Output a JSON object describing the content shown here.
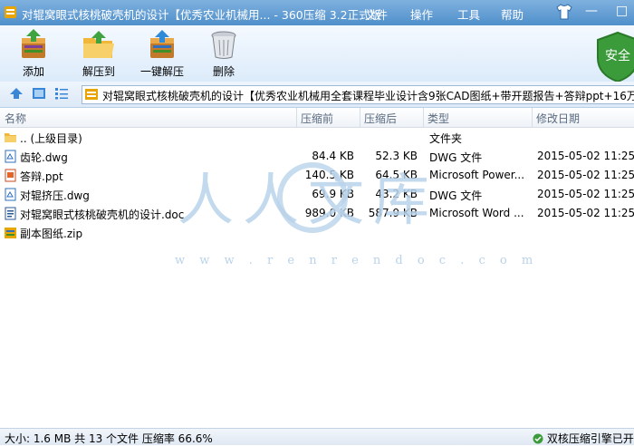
{
  "window": {
    "title": "对辊窝眼式核桃破壳机的设计【优秀农业机械用... - 360压缩 3.2正式版",
    "menu": [
      "文件",
      "操作",
      "工具",
      "帮助"
    ],
    "controls": {
      "minimize": "—",
      "maximize": "□"
    }
  },
  "toolbar": {
    "add": "添加",
    "extract_to": "解压到",
    "one_click_extract": "一键解压",
    "delete": "删除",
    "safe_badge": "安全"
  },
  "address": {
    "path": "对辊窝眼式核桃破壳机的设计【优秀农业机械用全套课程毕业设计含9张CAD图纸+带开题报告+答辩ppt+16万"
  },
  "columns": {
    "name": "名称",
    "size": "压缩前",
    "packed": "压缩后",
    "type": "类型",
    "modified": "修改日期"
  },
  "files": [
    {
      "icon": "folder-icon",
      "name": ".. (上级目录)",
      "size": "",
      "packed": "",
      "type": "文件夹",
      "modified": ""
    },
    {
      "icon": "dwg-file-icon",
      "name": "齿轮.dwg",
      "size": "84.4 KB",
      "packed": "52.3 KB",
      "type": "DWG 文件",
      "modified": "2015-05-02 11:25"
    },
    {
      "icon": "ppt-file-icon",
      "name": "答辩.ppt",
      "size": "140.5 KB",
      "packed": "64.5 KB",
      "type": "Microsoft Power...",
      "modified": "2015-05-02 11:25"
    },
    {
      "icon": "dwg-file-icon",
      "name": "对辊挤压.dwg",
      "size": "69.9 KB",
      "packed": "43.2 KB",
      "type": "DWG 文件",
      "modified": "2015-05-02 11:25"
    },
    {
      "icon": "doc-file-icon",
      "name": "对辊窝眼式核桃破壳机的设计.doc",
      "size": "989.0 KB",
      "packed": "587.9 KB",
      "type": "Microsoft Word ...",
      "modified": "2015-05-02 11:25"
    },
    {
      "icon": "zip-file-icon",
      "name": "副本图纸.zip",
      "size": "",
      "packed": "",
      "type": "",
      "modified": ""
    }
  ],
  "watermark": {
    "text": "人人文库",
    "url": "w w w . r e n r e n d o c . c o m"
  },
  "status": {
    "summary": "大小: 1.6 MB 共 13 个文件 压缩率 66.6%",
    "engine": "双核压缩引擎已开"
  },
  "colors": {
    "titlebar": "#5b98d1",
    "toolbar_bg": "#e6f0fb",
    "watermark": "#b9d3ea",
    "safe_green": "#3b9b3b"
  }
}
